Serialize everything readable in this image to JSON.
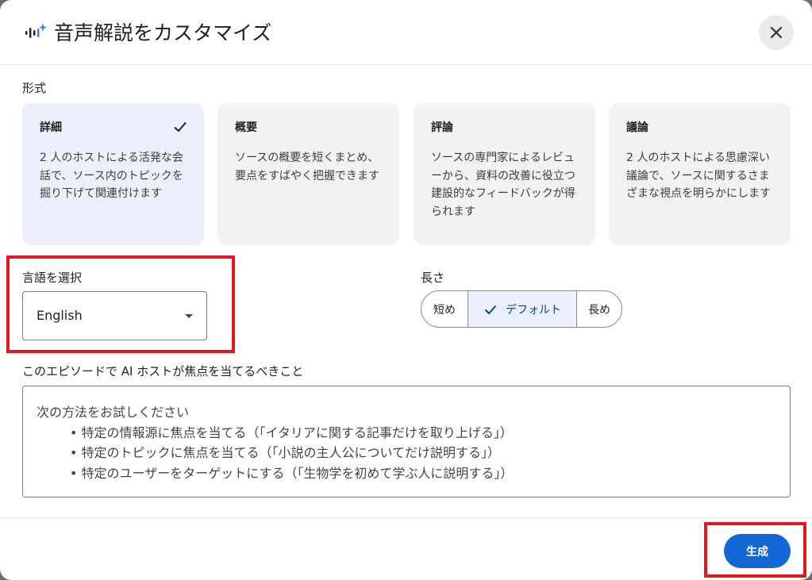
{
  "dialog": {
    "title": "音声解説をカスタマイズ",
    "title_icon": "sparkle-audio-icon",
    "close_icon": "close-icon"
  },
  "format": {
    "label": "形式",
    "cards": [
      {
        "title": "詳細",
        "desc": "2 人のホストによる活発な会話で、ソース内のトピックを掘り下げて関連付けます",
        "selected": true
      },
      {
        "title": "概要",
        "desc": "ソースの概要を短くまとめ、要点をすばやく把握できます",
        "selected": false
      },
      {
        "title": "評論",
        "desc": "ソースの専門家によるレビューから、資料の改善に役立つ建設的なフィードバックが得られます",
        "selected": false
      },
      {
        "title": "議論",
        "desc": "2 人のホストによる思慮深い議論で、ソースに関するさまざまな視点を明らかにします",
        "selected": false
      }
    ]
  },
  "language": {
    "label": "言語を選択",
    "value": "English"
  },
  "length": {
    "label": "長さ",
    "options": [
      "短め",
      "デフォルト",
      "長め"
    ],
    "selected": "デフォルト"
  },
  "focus": {
    "label": "このエピソードで AI ホストが焦点を当てるべきこと",
    "placeholder_intro": "次の方法をお試しください",
    "placeholder_items": [
      "特定の情報源に焦点を当てる（「イタリアに関する記事だけを取り上げる」）",
      "特定のトピックに焦点を当てる（「小説の主人公についてだけ説明する」）",
      "特定のユーザーをターゲットにする（「生物学を初めて学ぶ人に説明する」）"
    ]
  },
  "footer": {
    "generate_label": "生成"
  },
  "colors": {
    "accent": "#1366d6",
    "selected_bg": "#ecf0fc",
    "highlight_red": "#e3171f"
  }
}
